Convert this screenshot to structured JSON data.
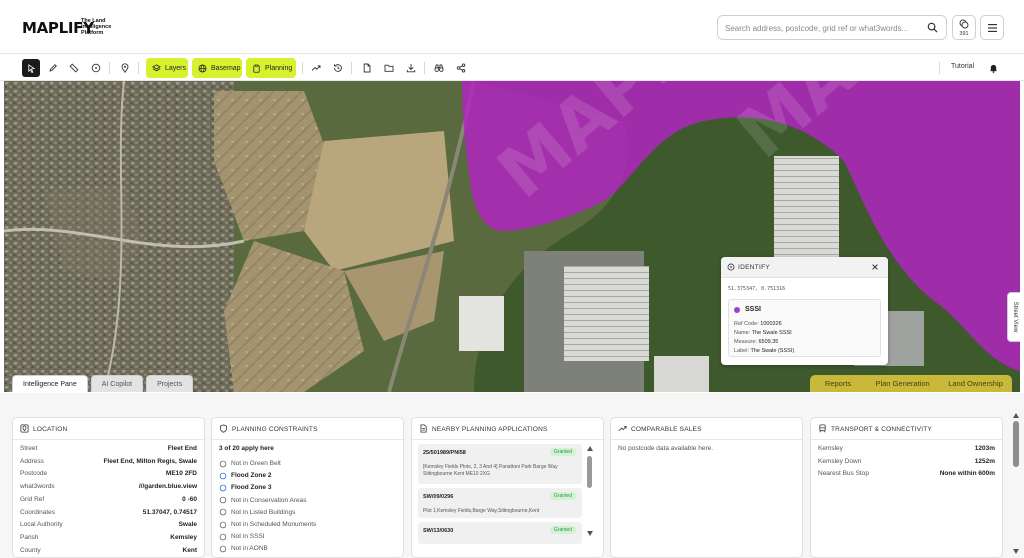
{
  "header": {
    "logo": "MAPLIFY",
    "logo_sub": "The Land Intelligence Platform",
    "search_placeholder": "Search address, postcode, grid ref or what3words...",
    "credits": "391"
  },
  "toolbar": {
    "layers": "Layers",
    "basemap": "Basemap",
    "planning": "Planning",
    "tutorial": "Tutorial"
  },
  "map": {
    "street_view": "Street View",
    "panel_tabs": [
      "Intelligence Pane",
      "AI Copilot",
      "Projects"
    ],
    "right_tabs": [
      "Reports",
      "Plan Generation",
      "Land Ownership"
    ],
    "identify": {
      "title": "IDENTIFY",
      "coords": "51.375347, 0.751316",
      "name": "SSSI",
      "ref_label": "Ref Code:",
      "ref": "1000326",
      "name_label": "Name:",
      "name_value": "The Swale SSSI",
      "measure_label": "Measure:",
      "measure": "6509.35",
      "label_label": "Label:",
      "label": "The Swale (SSSI)"
    },
    "colors": {
      "sssi": "#b422c4",
      "accent": "#d8f12e"
    }
  },
  "location": {
    "title": "LOCATION",
    "rows": [
      {
        "k": "Street",
        "v": "Fleet End"
      },
      {
        "k": "Address",
        "v": "Fleet End, Milton Regis, Swale"
      },
      {
        "k": "Postcode",
        "v": "ME10 2FD"
      },
      {
        "k": "what3words",
        "v": "///garden.blue.view"
      },
      {
        "k": "Grid Ref",
        "v": "0 -60"
      },
      {
        "k": "Coordinates",
        "v": "51.37047, 0.74517"
      },
      {
        "k": "Local Authority",
        "v": "Swale"
      },
      {
        "k": "Parish",
        "v": "Kemsley"
      },
      {
        "k": "County",
        "v": "Kent"
      }
    ]
  },
  "planning": {
    "title": "PLANNING CONSTRAINTS",
    "summary": "3 of 20 apply here",
    "items": [
      {
        "label": "Not in Green Belt",
        "hl": false
      },
      {
        "label": "Flood Zone 2",
        "hl": true
      },
      {
        "label": "Flood Zone 3",
        "hl": true
      },
      {
        "label": "Not in Conservation Areas",
        "hl": false
      },
      {
        "label": "Not in Listed Buildings",
        "hl": false
      },
      {
        "label": "Not in Scheduled Monuments",
        "hl": false
      },
      {
        "label": "Not in SSSI",
        "hl": false
      },
      {
        "label": "Not in AONB",
        "hl": false
      }
    ]
  },
  "applications": {
    "title": "NEARBY PLANNING APPLICATIONS",
    "items": [
      {
        "ref": "25/501989/PNI58",
        "status": "Granted",
        "desc": "[Kemsley Fields Plots, 2, 3 And 4] Panattoni Park Barge Way Sittingbourne Kent ME10 2XG"
      },
      {
        "ref": "SW/09/0296",
        "status": "Granted",
        "desc": "Plot 1,Kemsley Fields,Barge Way,Sittingbourne,Kent"
      },
      {
        "ref": "SW/13/0630",
        "status": "Granted",
        "desc": ""
      }
    ]
  },
  "sales": {
    "title": "COMPARABLE SALES",
    "empty": "No postcode data available here."
  },
  "transport": {
    "title": "TRANSPORT & CONNECTIVITY",
    "rows": [
      {
        "k": "Kemsley",
        "v": "1203m"
      },
      {
        "k": "Kemsley Down",
        "v": "1252m"
      },
      {
        "k": "Nearest Bus Stop",
        "v": "None within 600m"
      }
    ]
  }
}
